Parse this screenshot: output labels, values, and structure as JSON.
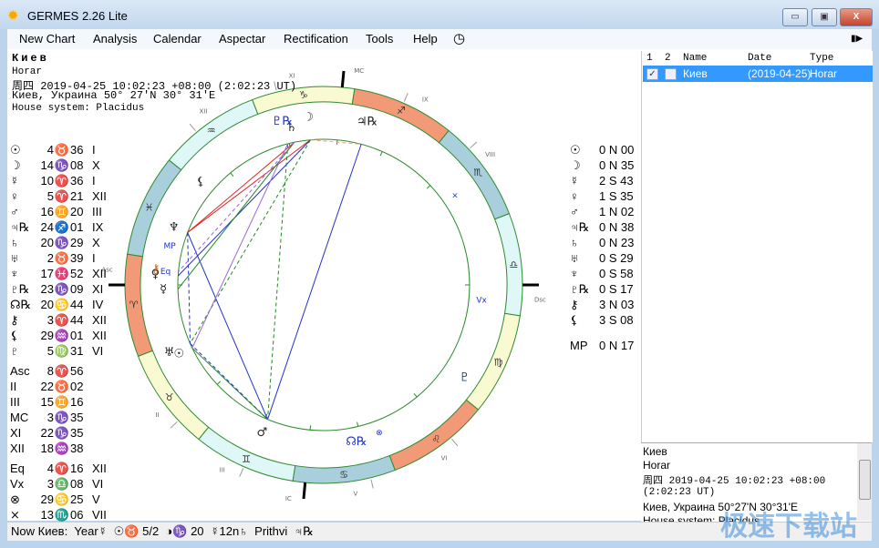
{
  "window": {
    "title": "GERMES 2.26 Lite",
    "app_icon": "sun-icon",
    "minimize": "▭",
    "maximize": "▣",
    "close": "X"
  },
  "menu": [
    "New Chart",
    "Analysis",
    "Calendar",
    "Aspectar",
    "Rectification",
    "Tools",
    "Help"
  ],
  "menu_icons": {
    "clock": "◷",
    "more": "▮▶"
  },
  "header": {
    "name": "Киев",
    "type": "Horar",
    "datetime": "周四 2019-04-25 10:02:23 +08:00 (2:02:23 UT)",
    "place": "Киев, Украина 50° 27'N 30° 31'E",
    "house_system": "House system: Placidus"
  },
  "planets": [
    {
      "glyph": "☉",
      "deg": "4",
      "sign": "♉",
      "min": "36",
      "house": "I",
      "lon": 34.6,
      "lat": "0 N 00"
    },
    {
      "glyph": "☽",
      "deg": "14",
      "sign": "♑",
      "min": "08",
      "house": "X",
      "lon": 284.13,
      "lat": "0 N 35"
    },
    {
      "glyph": "☿",
      "deg": "10",
      "sign": "♈",
      "min": "36",
      "house": "I",
      "lon": 10.6,
      "lat": "2 S 43"
    },
    {
      "glyph": "♀",
      "deg": "5",
      "sign": "♈",
      "min": "21",
      "house": "XII",
      "lon": 5.35,
      "lat": "1 S 35"
    },
    {
      "glyph": "♂",
      "deg": "16",
      "sign": "♊",
      "min": "20",
      "house": "III",
      "lon": 76.33,
      "lat": "1 N 02"
    },
    {
      "glyph": "♃℞",
      "deg": "24",
      "sign": "♐",
      "min": "01",
      "house": "IX",
      "lon": 264.02,
      "lat": "0 N 38"
    },
    {
      "glyph": "♄",
      "deg": "20",
      "sign": "♑",
      "min": "29",
      "house": "X",
      "lon": 290.48,
      "lat": "0 N 23"
    },
    {
      "glyph": "♅",
      "deg": "2",
      "sign": "♉",
      "min": "39",
      "house": "I",
      "lon": 32.65,
      "lat": "0 S 29"
    },
    {
      "glyph": "♆",
      "deg": "17",
      "sign": "♓",
      "min": "52",
      "house": "XII",
      "lon": 347.87,
      "lat": "0 S 58"
    },
    {
      "glyph": "♇℞",
      "deg": "23",
      "sign": "♑",
      "min": "09",
      "house": "XI",
      "lon": 293.15,
      "lat": "0 S 17"
    },
    {
      "glyph": "☊℞",
      "deg": "20",
      "sign": "♋",
      "min": "44",
      "house": "IV",
      "lon": 110.73
    },
    {
      "glyph": "⚷",
      "deg": "3",
      "sign": "♈",
      "min": "44",
      "house": "XII",
      "lon": 3.73,
      "lat": "3 N 03"
    },
    {
      "glyph": "⚸",
      "deg": "29",
      "sign": "♒",
      "min": "01",
      "house": "XII",
      "lon": 329.02,
      "lat": "3 S 08"
    },
    {
      "glyph": "♇",
      "deg": "5",
      "sign": "♍",
      "min": "31",
      "house": "VI",
      "lon": 155.52
    }
  ],
  "mp_latitude": {
    "label": "MP",
    "lat": "0 N 17"
  },
  "houses": [
    {
      "label": "Asc",
      "deg": "8",
      "sign": "♈",
      "min": "56",
      "lon": 8.93
    },
    {
      "label": "II",
      "deg": "22",
      "sign": "♉",
      "min": "02",
      "lon": 52.03
    },
    {
      "label": "III",
      "deg": "15",
      "sign": "♊",
      "min": "16",
      "lon": 75.27
    },
    {
      "label": "MC",
      "deg": "3",
      "sign": "♑",
      "min": "35",
      "lon": 273.58
    },
    {
      "label": "XI",
      "deg": "22",
      "sign": "♑",
      "min": "35",
      "lon": 292.58
    },
    {
      "label": "XII",
      "deg": "18",
      "sign": "♒",
      "min": "38",
      "lon": 318.63
    }
  ],
  "points": [
    {
      "label": "Eq",
      "deg": "4",
      "sign": "♈",
      "min": "16",
      "house": "XII",
      "lon": 4.27
    },
    {
      "label": "Vx",
      "deg": "3",
      "sign": "♎",
      "min": "08",
      "house": "VI",
      "lon": 183.13
    },
    {
      "label": "⊗",
      "deg": "29",
      "sign": "♋",
      "min": "25",
      "house": "V",
      "lon": 119.42
    },
    {
      "label": "⨯",
      "deg": "13",
      "sign": "♏",
      "min": "06",
      "house": "VII",
      "lon": 223.1
    }
  ],
  "wheel": {
    "signs": [
      "♈",
      "♉",
      "♊",
      "♋",
      "♌",
      "♍",
      "♎",
      "♏",
      "♐",
      "♑",
      "♒",
      "♓"
    ],
    "sign_colors": [
      "#f29a78",
      "#fafad2",
      "#dff7f7",
      "#a9cfdc"
    ],
    "cusp_labels": [
      "Asc",
      "II",
      "III",
      "IC",
      "V",
      "VI",
      "Dsc",
      "VIII",
      "IX",
      "MC",
      "XI",
      "XII"
    ],
    "cusp_lons": [
      8.93,
      52.03,
      75.27,
      93.58,
      112.58,
      138.63,
      188.93,
      232.03,
      255.27,
      273.58,
      292.58,
      318.63
    ],
    "inner_labels": [
      {
        "t": "MP",
        "lon": 355
      },
      {
        "t": "Eq",
        "lon": 4.27
      },
      {
        "t": "Vx",
        "lon": 183.13
      },
      {
        "t": "⊗",
        "lon": 119.42
      },
      {
        "t": "⨯",
        "lon": 223.1
      }
    ],
    "aspects": [
      {
        "a": 284.13,
        "b": 347.87,
        "color": "#e02020",
        "dash": false
      },
      {
        "a": 290.48,
        "b": 347.87,
        "color": "#e02020",
        "dash": false
      },
      {
        "a": 264.02,
        "b": 76.33,
        "color": "#2233cc",
        "dash": false
      },
      {
        "a": 347.87,
        "b": 76.33,
        "color": "#2233cc",
        "dash": false
      },
      {
        "a": 32.65,
        "b": 76.33,
        "color": "#2233cc",
        "dash": true
      },
      {
        "a": 347.87,
        "b": 32.65,
        "color": "#2233cc",
        "dash": true
      },
      {
        "a": 284.13,
        "b": 5.35,
        "color": "#2233cc",
        "dash": false
      },
      {
        "a": 34.6,
        "b": 76.33,
        "color": "#228822",
        "dash": false
      },
      {
        "a": 293.15,
        "b": 76.33,
        "color": "#228822",
        "dash": true
      },
      {
        "a": 290.48,
        "b": 10.6,
        "color": "#228822",
        "dash": false
      },
      {
        "a": 284.13,
        "b": 32.65,
        "color": "#228822",
        "dash": true
      },
      {
        "a": 293.15,
        "b": 34.6,
        "color": "#9966dd",
        "dash": false
      },
      {
        "a": 290.48,
        "b": 3.73,
        "color": "#9966dd",
        "dash": true
      },
      {
        "a": 284.13,
        "b": 264.02,
        "color": "#e8a070",
        "dash": true
      }
    ]
  },
  "chart_list": {
    "headers": [
      "1",
      "2",
      "Name",
      "Date",
      "Type"
    ],
    "rows": [
      {
        "checked1": "✓",
        "name": "Киев",
        "date": "(2019-04-25)",
        "type": "Horar"
      }
    ]
  },
  "info": [
    "Киев",
    "Horar",
    "周四 2019-04-25 10:02:23 +08:00",
    "(2:02:23 UT)",
    "Киев, Украина 50°27'N 30°31'E",
    "House system: Placidus"
  ],
  "status": "Now Киев:  Year☿  ☉♉ 5/2  ◑♑ 20  ☿12n♄  Prithvi  ♃℞",
  "watermark": "极速下载站"
}
